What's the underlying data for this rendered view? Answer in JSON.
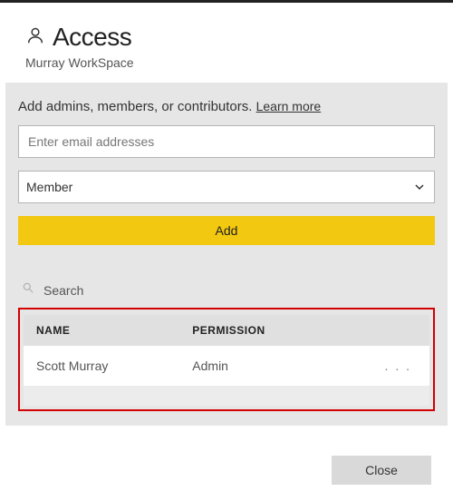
{
  "header": {
    "title": "Access",
    "subtitle": "Murray WorkSpace"
  },
  "form": {
    "instruction": "Add admins, members, or contributors.",
    "learn_more": "Learn more",
    "email_placeholder": "Enter email addresses",
    "role_selected": "Member",
    "add_label": "Add"
  },
  "search": {
    "label": "Search"
  },
  "table": {
    "col_name": "NAME",
    "col_permission": "PERMISSION",
    "rows": [
      {
        "name": "Scott Murray",
        "permission": "Admin"
      }
    ],
    "row_actions_glyph": ". . ."
  },
  "footer": {
    "close_label": "Close"
  }
}
